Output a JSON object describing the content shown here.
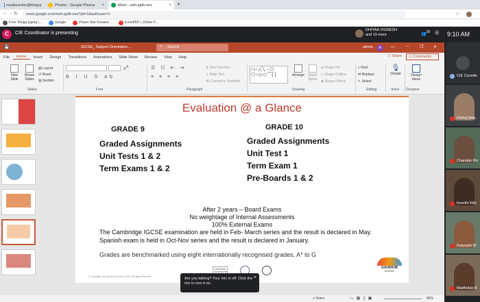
{
  "browser": {
    "tabs": [
      {
        "label": "mediacenter@theguj",
        "color": "#4285f4",
        "active": false
      },
      {
        "label": "Photos - Google Photos",
        "color": "#fbbc04",
        "active": false
      },
      {
        "label": "Meet - xwh-pjdb-oes",
        "color": "#0f9d58",
        "active": true
      }
    ],
    "url": "meet.google.com/xwh-pjdb-oes?pli=1&authuser=1",
    "bookmarks": [
      "Free Telugu typing t...",
      "Google",
      "Power Star Konane...",
      "iLovePDF | Online P..."
    ]
  },
  "meet": {
    "logo_letter": "C",
    "presenting_title": "CIE Coordinator is presenting",
    "presenter_name": "DHIYAA VIGNESH",
    "presenter_more": "and 19 more",
    "participant_count": "28",
    "time": "9:10 AM",
    "participants": [
      {
        "name": "CIE Coordin"
      },
      {
        "name": "PRINCIPAL"
      },
      {
        "name": "Chandan Ro"
      },
      {
        "name": "Keerthi Rith"
      },
      {
        "name": "Katyayini Bi"
      },
      {
        "name": "Madhukar R"
      }
    ],
    "toast": {
      "text": "Are you talking? Your mic is off. Click the mic to turn it on.",
      "close": "×"
    }
  },
  "ppt": {
    "filename": "IGCSE_ Subject Orientation...",
    "search_placeholder": "Search",
    "user": "admin",
    "user_initial": "A",
    "menus": [
      "File",
      "Home",
      "Insert",
      "Design",
      "Transitions",
      "Animations",
      "Slide Show",
      "Review",
      "View",
      "Help"
    ],
    "active_menu": "Home",
    "share_label": "Share",
    "comments_label": "Comments",
    "ribbon": {
      "new_slide": "New Slide",
      "reuse_slides": "Reuse Slides",
      "layout": "Layout",
      "reset": "Reset",
      "section": "Section",
      "slides_group": "Slides",
      "font_group": "Font",
      "paragraph_group": "Paragraph",
      "text_direction": "Text Direction",
      "align_text": "Align Text",
      "convert_smartart": "Convert to SmartArt",
      "drawing_group": "Drawing",
      "arrange": "Arrange",
      "quick_styles": "Quick Styles",
      "shape_fill": "Shape Fill",
      "shape_outline": "Shape Outline",
      "shape_effects": "Shape Effects",
      "find": "Find",
      "replace": "Replace",
      "select": "Select",
      "editing_group": "Editing",
      "dictate": "Dictate",
      "voice_group": "Voice",
      "design_ideas": "Design Ideas",
      "designer_group": "Designer"
    },
    "slide": {
      "title": "Evaluation @ a Glance",
      "grade9": {
        "heading": "GRADE 9",
        "items": [
          "Graded Assignments",
          "Unit Tests 1 & 2",
          "Term Exams 1 & 2"
        ]
      },
      "grade10": {
        "heading": "GRADE 10",
        "items": [
          "Graded Assignments",
          "Unit Test 1",
          "Term Exam 1",
          "Pre-Boards 1 & 2"
        ]
      },
      "centered": [
        "After 2 years – Board Exams",
        "No weightage of Internal Assessments",
        "100% External Exams"
      ],
      "body1": "The Cambridge IGCSE examination are held in Feb- March series and the result is declared in May.",
      "body2": "Spanish exam is held in Oct-Nov series and the result is declared in January.",
      "body3": "Grades are benchmarked using eight internationally recognised grades, A* to G",
      "footer": "© Copyright The Gaudium School, 2020. All rights reserved",
      "school_logo": "GAUDIUM",
      "school_sub": "SCHOOL",
      "cambridge_label": "Cambridge Assessment"
    },
    "status": {
      "notes": "Notes",
      "zoom": "86%"
    }
  }
}
